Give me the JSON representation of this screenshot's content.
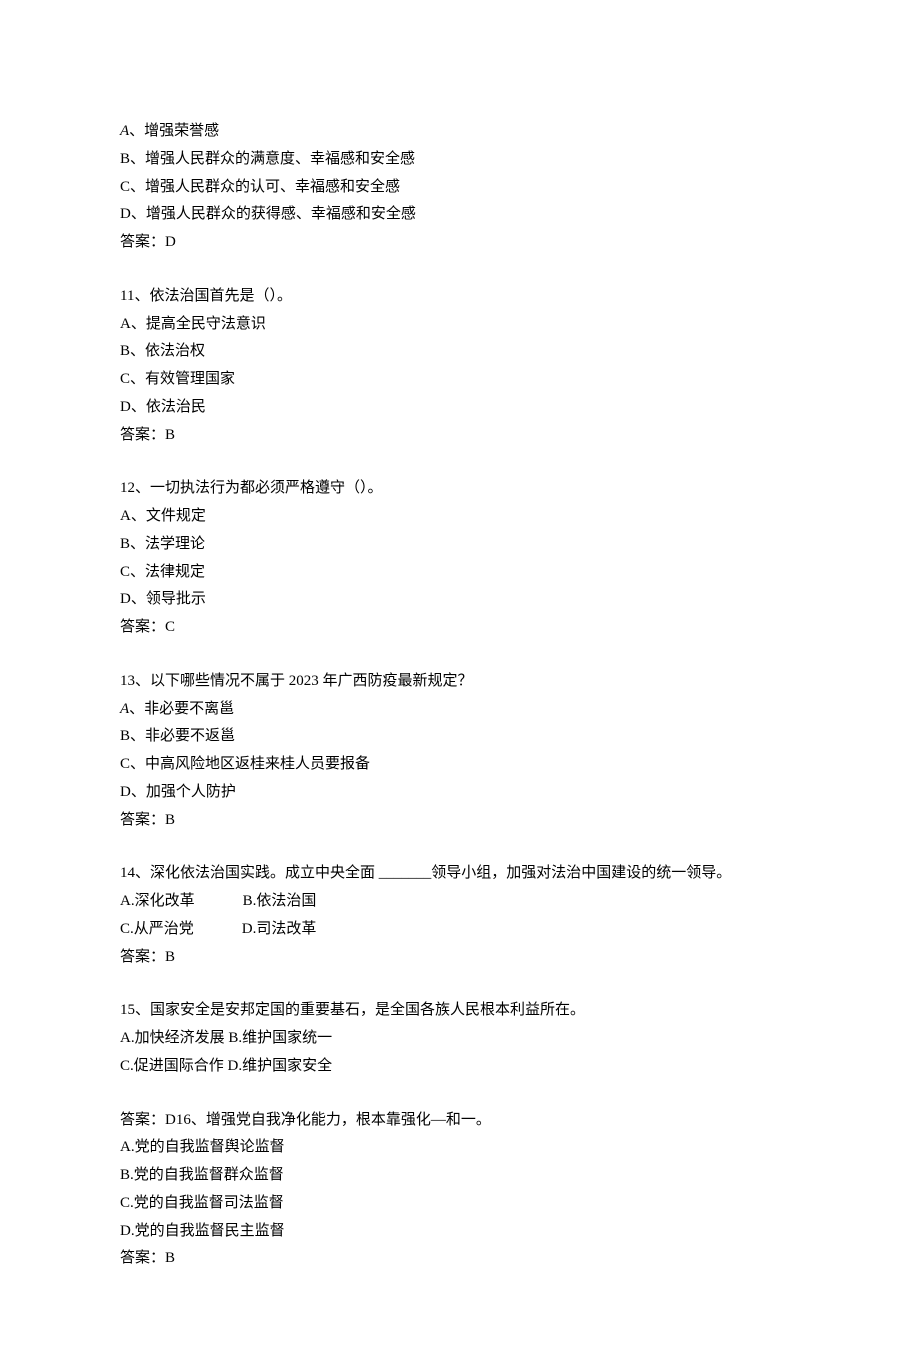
{
  "q10_opts": {
    "a_prefix": "A",
    "a_text": "、增强荣誉感",
    "b": "B、增强人民群众的满意度、幸福感和安全感",
    "c": "C、增强人民群众的认可、幸福感和安全感",
    "d": "D、增强人民群众的获得感、幸福感和安全感",
    "ans": "答案：D"
  },
  "q11": {
    "stem": "11、依法治国首先是（）。",
    "a": "A、提高全民守法意识",
    "b": "B、依法治权",
    "c": "C、有效管理国家",
    "d": "D、依法治民",
    "ans": "答案：B"
  },
  "q12": {
    "stem": "12、一切执法行为都必须严格遵守（）。",
    "a": "A、文件规定",
    "b": "B、法学理论",
    "c": "C、法律规定",
    "d": "D、领导批示",
    "ans": "答案：C"
  },
  "q13": {
    "stem": "13、以下哪些情况不属于 2023 年广西防疫最新规定？",
    "a_prefix": "A",
    "a_text": "、非必要不离邕",
    "b": "B、非必要不返邕",
    "c": "C、中高风险地区返桂来桂人员要报备",
    "d": "D、加强个人防护",
    "ans": "答案：B"
  },
  "q14": {
    "stem": "14、深化依法治国实践。成立中央全面 _______领导小组，加强对法治中国建设的统一领导。",
    "a": "A.深化改革",
    "b": "B.依法治国",
    "c": "C.从严治党",
    "d": "D.司法改革",
    "ans": "答案：B"
  },
  "q15": {
    "stem": "15、国家安全是安邦定国的重要基石，是全国各族人民根本利益所在。",
    "ab": "A.加快经济发展 B.维护国家统一",
    "cd": "C.促进国际合作 D.维护国家安全"
  },
  "q16": {
    "ans_and_stem": "答案：D16、增强党自我净化能力，根本靠强化—和一。",
    "a": "A.党的自我监督舆论监督",
    "b": "B.党的自我监督群众监督",
    "c": "C.党的自我监督司法监督",
    "d": "D.党的自我监督民主监督",
    "ans": "答案：B"
  }
}
